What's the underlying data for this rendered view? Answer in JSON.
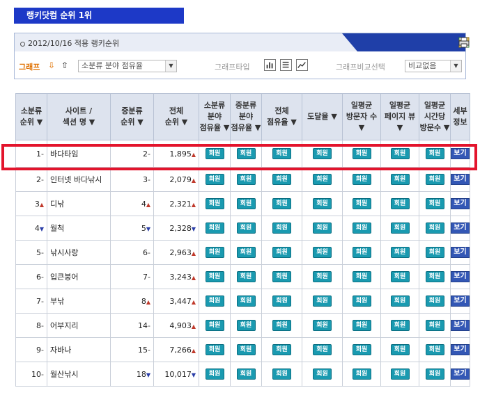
{
  "title": "랭키닷컴 순위 1위",
  "panel": {
    "date_label": "2012/10/16 적용 랭키순위",
    "graph_label": "그래프",
    "category_select": "소분류 분야 점유율",
    "graph_type_label": "그래프타입",
    "compare_label": "그래프비교선택",
    "compare_select": "비교없음"
  },
  "headers": {
    "sub_rank": "소분류\n순위 ▼",
    "site": "사이트 /\n섹션 명 ▼",
    "mid_rank": "중분류\n순위 ▼",
    "total_rank": "전체\n순위 ▼",
    "sub_share": "소분류\n분야\n점유율 ▼",
    "mid_share": "중분류\n분야\n점유율 ▼",
    "total_share": "전체\n점유율 ▼",
    "reach": "도달율 ▼",
    "daily_visitors": "일평균\n방문자 수\n▼",
    "daily_pageviews": "일평균\n페이지 뷰\n▼",
    "time_per_visit": "일평균\n시간당\n방문수 ▼",
    "detail": "세부\n정보"
  },
  "badge_label": "회원",
  "view_label": "보기",
  "rows": [
    {
      "sub_rank": "1",
      "sub_trend": "-",
      "site": "바다타임",
      "mid_rank": "2",
      "mid_trend": "-",
      "total_rank": "1,895",
      "total_trend": "up"
    },
    {
      "sub_rank": "2",
      "sub_trend": "-",
      "site": "인터넷 바다낚시",
      "mid_rank": "3",
      "mid_trend": "-",
      "total_rank": "2,079",
      "total_trend": "up"
    },
    {
      "sub_rank": "3",
      "sub_trend": "up",
      "site": "디낚",
      "mid_rank": "4",
      "mid_trend": "up",
      "total_rank": "2,321",
      "total_trend": "up"
    },
    {
      "sub_rank": "4",
      "sub_trend": "down",
      "site": "월척",
      "mid_rank": "5",
      "mid_trend": "down",
      "total_rank": "2,328",
      "total_trend": "down"
    },
    {
      "sub_rank": "5",
      "sub_trend": "-",
      "site": "낚시사랑",
      "mid_rank": "6",
      "mid_trend": "-",
      "total_rank": "2,963",
      "total_trend": "up"
    },
    {
      "sub_rank": "6",
      "sub_trend": "-",
      "site": "입큰붕어",
      "mid_rank": "7",
      "mid_trend": "-",
      "total_rank": "3,243",
      "total_trend": "up"
    },
    {
      "sub_rank": "7",
      "sub_trend": "-",
      "site": "부낚",
      "mid_rank": "8",
      "mid_trend": "up",
      "total_rank": "3,447",
      "total_trend": "up"
    },
    {
      "sub_rank": "8",
      "sub_trend": "-",
      "site": "어부지리",
      "mid_rank": "14",
      "mid_trend": "-",
      "total_rank": "4,903",
      "total_trend": "up"
    },
    {
      "sub_rank": "9",
      "sub_trend": "-",
      "site": "자바나",
      "mid_rank": "15",
      "mid_trend": "-",
      "total_rank": "7,266",
      "total_trend": "up"
    },
    {
      "sub_rank": "10",
      "sub_trend": "-",
      "site": "월산낚시",
      "mid_rank": "18",
      "mid_trend": "down",
      "total_rank": "10,017",
      "total_trend": "down"
    }
  ]
}
